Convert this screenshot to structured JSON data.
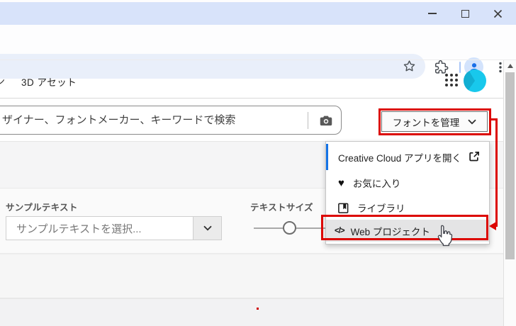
{
  "window": {
    "controls": [
      "minimize-icon",
      "maximize-icon",
      "close-icon"
    ]
  },
  "browser": {
    "icons": [
      "bookmark-star-icon",
      "extensions-puzzle-icon",
      "profile-avatar-icon",
      "kebab-menu-icon"
    ]
  },
  "nav": {
    "clipped_fragment": "ン",
    "item_3d": "3D アセット",
    "icons": [
      "apps-grid-icon",
      "user-avatar"
    ]
  },
  "search": {
    "placeholder": "ザイナー、フォントメーカー、キーワードで検索",
    "icon": "camera-icon"
  },
  "manage": {
    "label": "フォントを管理",
    "icon": "chevron-down-icon"
  },
  "menu": {
    "items": [
      {
        "label": "Creative Cloud アプリを開く",
        "icon": "external-link-icon",
        "focused": true
      },
      {
        "label": "お気に入り",
        "icon": "heart-icon",
        "glyph": "♥"
      },
      {
        "label": "ライブラリ",
        "icon": "library-icon"
      },
      {
        "label": "Web プロジェクト",
        "icon": "code-icon",
        "glyph": "</>",
        "highlighted": true
      }
    ]
  },
  "sample": {
    "label": "サンプルテキスト",
    "value": "サンプルテキストを選択..."
  },
  "textsize": {
    "label": "テキストサイズ"
  },
  "annotation": {
    "red": "#dc0500",
    "target": "Web プロジェクト"
  },
  "colors": {
    "titlebar": "#d8e3fa",
    "omnibox": "#e9effa",
    "focus_bar_blue": "#1473e6",
    "avatar_cyan": "#18c8ec",
    "highlight_gray": "#e4e4e5"
  }
}
